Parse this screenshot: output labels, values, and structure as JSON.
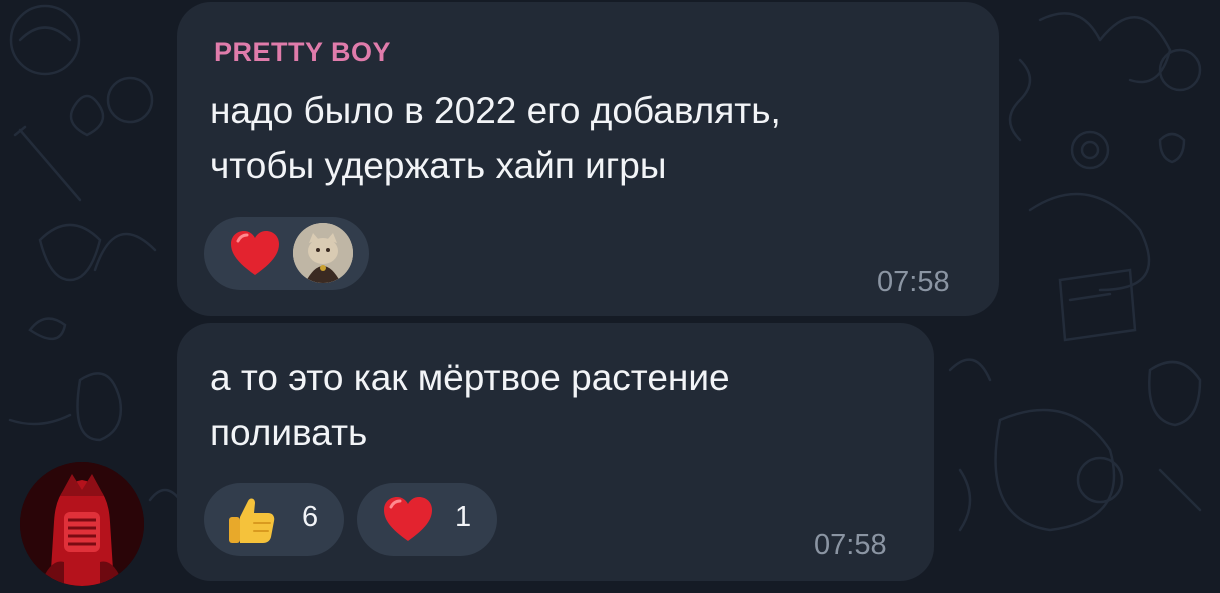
{
  "messages": [
    {
      "sender": "PRETTY BOY",
      "text": "надо было в 2022 его добавлять,\nчтобы удержать хайп игры",
      "time": "07:58",
      "reactions": [
        {
          "emoji": "red-heart",
          "reactor_avatar": "cat-avatar"
        }
      ]
    },
    {
      "text": "а то это как мёртвое растение\nполивать",
      "time": "07:58",
      "reactions": [
        {
          "emoji": "thumbs-up",
          "count": "6"
        },
        {
          "emoji": "red-heart",
          "count": "1"
        }
      ]
    }
  ],
  "colors": {
    "background": "#151b25",
    "bubble": "#222a36",
    "reaction_pill": "#323d4c",
    "sender_name": "#e07cab",
    "text": "#f2f4f7",
    "time": "#8b95a3",
    "avatar_red": "#d41a24"
  },
  "icons": {
    "heart": "red-heart-icon",
    "thumbs_up": "thumbs-up-icon",
    "sender_avatar": "red-masked-figure-avatar"
  }
}
